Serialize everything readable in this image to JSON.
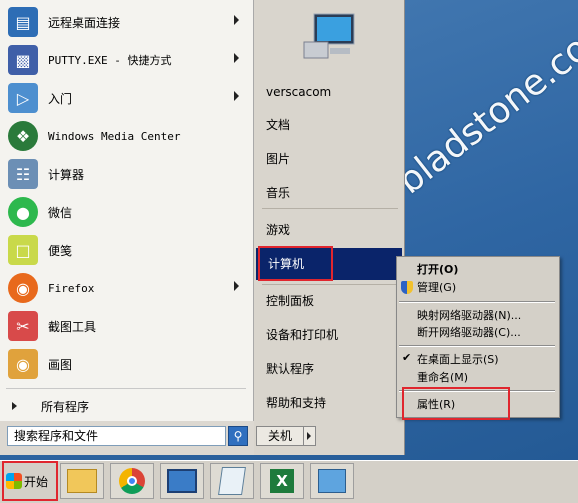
{
  "programs": [
    {
      "label": "远程桌面连接",
      "icon": "remote-desktop-icon",
      "has_arrow": true
    },
    {
      "label": "PUTTY.EXE - 快捷方式",
      "icon": "putty-icon",
      "has_arrow": true
    },
    {
      "label": "入门",
      "icon": "getting-started-icon",
      "has_arrow": true
    },
    {
      "label": "Windows Media Center",
      "icon": "windows-logo-icon",
      "has_arrow": false
    },
    {
      "label": "计算器",
      "icon": "calculator-icon",
      "has_arrow": false
    },
    {
      "label": "微信",
      "icon": "wechat-icon",
      "has_arrow": false
    },
    {
      "label": "便笺",
      "icon": "sticky-notes-icon",
      "has_arrow": false
    },
    {
      "label": "Firefox",
      "icon": "firefox-icon",
      "has_arrow": true
    },
    {
      "label": "截图工具",
      "icon": "snipping-tool-icon",
      "has_arrow": false
    },
    {
      "label": "画图",
      "icon": "paint-icon",
      "has_arrow": false
    }
  ],
  "all_programs": "所有程序",
  "search_placeholder": "搜索程序和文件",
  "right_items": {
    "user": "verscacom",
    "documents": "文档",
    "pictures": "图片",
    "music": "音乐",
    "games": "游戏",
    "computer": "计算机",
    "control_panel": "控制面板",
    "devices": "设备和打印机",
    "default_programs": "默认程序",
    "help": "帮助和支持"
  },
  "shutdown_label": "关机",
  "context_menu": {
    "open": "打开(O)",
    "manage": "管理(G)",
    "map_drive": "映射网络驱动器(N)...",
    "disconnect_drive": "断开网络驱动器(C)...",
    "show_on_desktop": "在桌面上显示(S)",
    "rename": "重命名(M)",
    "properties": "属性(R)"
  },
  "start_label": "开始",
  "watermark": "bladstone.com",
  "colors": {
    "highlight": "#0a246a",
    "annotation_red": "#e0262e",
    "desktop": "#3a6ea5"
  }
}
